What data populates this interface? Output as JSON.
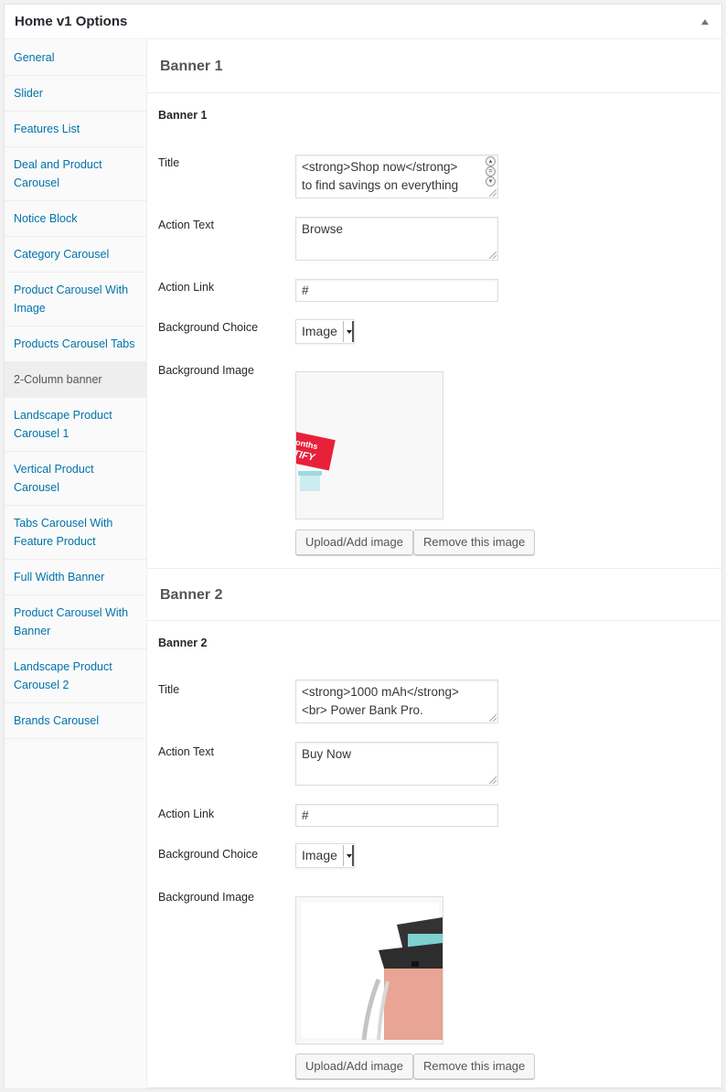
{
  "panel": {
    "title": "Home v1 Options"
  },
  "sidebar": {
    "items": [
      {
        "label": "General"
      },
      {
        "label": "Slider"
      },
      {
        "label": "Features List"
      },
      {
        "label": "Deal and Product Carousel"
      },
      {
        "label": "Notice Block"
      },
      {
        "label": "Category Carousel"
      },
      {
        "label": "Product Carousel With Image"
      },
      {
        "label": "Products Carousel Tabs"
      },
      {
        "label": "2-Column banner"
      },
      {
        "label": "Landscape Product Carousel 1"
      },
      {
        "label": "Vertical Product Carousel"
      },
      {
        "label": "Tabs Carousel With Feature Product"
      },
      {
        "label": "Full Width Banner"
      },
      {
        "label": "Product Carousel With Banner"
      },
      {
        "label": "Landscape Product Carousel 2"
      },
      {
        "label": "Brands Carousel"
      }
    ],
    "active_index": 8
  },
  "labels": {
    "title": "Title",
    "action_text": "Action Text",
    "action_link": "Action Link",
    "background_choice": "Background Choice",
    "background_image": "Background Image",
    "upload_button": "Upload/Add image",
    "remove_button": "Remove this image"
  },
  "banner1": {
    "section_title": "Banner 1",
    "subheading": "Banner 1",
    "title_line1": "<strong>Shop now</strong>",
    "title_line2": "to find savings on everything",
    "action_text": "Browse",
    "action_link": "#",
    "background_choice": "Image",
    "image_sign_text": "onths",
    "image_sign_text2": "TIFY"
  },
  "banner2": {
    "section_title": "Banner 2",
    "subheading": "Banner 2",
    "title_line1": "<strong>1000 mAh</strong>",
    "title_line2": "<br> Power Bank Pro.",
    "action_text": "Buy Now",
    "action_link": "#",
    "background_choice": "Image"
  },
  "colors": {
    "link": "#0073aa",
    "active_nav_bg": "#eeeeee",
    "sign_red": "#e8213a",
    "powerbank_pink": "#e8a494",
    "powerbank_teal": "#7fd0d0"
  },
  "icons": {
    "collapse": "triangle-up-icon",
    "select": "chevron-down-icon",
    "resize": "resize-grip-icon"
  }
}
